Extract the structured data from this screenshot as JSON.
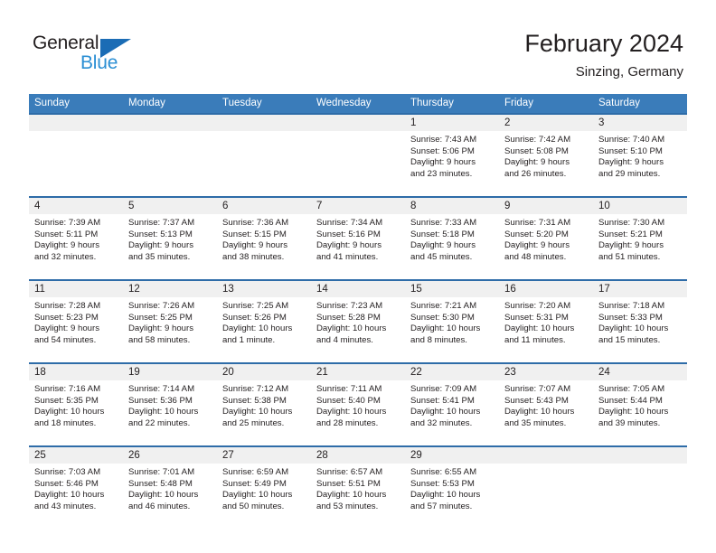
{
  "brand": {
    "name_top": "General",
    "name_bottom": "Blue",
    "color_dark": "#231f20",
    "color_blue": "#2b8fd4",
    "triangle_color": "#1b6cb5"
  },
  "header": {
    "title": "February 2024",
    "subtitle": "Sinzing, Germany"
  },
  "theme": {
    "header_bg": "#3a7cba",
    "row_divider": "#2e6ca8",
    "daynum_bg": "#f0f0f0",
    "body_bg": "#ffffff",
    "text": "#231f20"
  },
  "weekdays": [
    "Sunday",
    "Monday",
    "Tuesday",
    "Wednesday",
    "Thursday",
    "Friday",
    "Saturday"
  ],
  "weeks": [
    [
      {
        "day": "",
        "sunrise": "",
        "sunset": "",
        "daylight_line1": "",
        "daylight_line2": ""
      },
      {
        "day": "",
        "sunrise": "",
        "sunset": "",
        "daylight_line1": "",
        "daylight_line2": ""
      },
      {
        "day": "",
        "sunrise": "",
        "sunset": "",
        "daylight_line1": "",
        "daylight_line2": ""
      },
      {
        "day": "",
        "sunrise": "",
        "sunset": "",
        "daylight_line1": "",
        "daylight_line2": ""
      },
      {
        "day": "1",
        "sunrise": "Sunrise: 7:43 AM",
        "sunset": "Sunset: 5:06 PM",
        "daylight_line1": "Daylight: 9 hours",
        "daylight_line2": "and 23 minutes."
      },
      {
        "day": "2",
        "sunrise": "Sunrise: 7:42 AM",
        "sunset": "Sunset: 5:08 PM",
        "daylight_line1": "Daylight: 9 hours",
        "daylight_line2": "and 26 minutes."
      },
      {
        "day": "3",
        "sunrise": "Sunrise: 7:40 AM",
        "sunset": "Sunset: 5:10 PM",
        "daylight_line1": "Daylight: 9 hours",
        "daylight_line2": "and 29 minutes."
      }
    ],
    [
      {
        "day": "4",
        "sunrise": "Sunrise: 7:39 AM",
        "sunset": "Sunset: 5:11 PM",
        "daylight_line1": "Daylight: 9 hours",
        "daylight_line2": "and 32 minutes."
      },
      {
        "day": "5",
        "sunrise": "Sunrise: 7:37 AM",
        "sunset": "Sunset: 5:13 PM",
        "daylight_line1": "Daylight: 9 hours",
        "daylight_line2": "and 35 minutes."
      },
      {
        "day": "6",
        "sunrise": "Sunrise: 7:36 AM",
        "sunset": "Sunset: 5:15 PM",
        "daylight_line1": "Daylight: 9 hours",
        "daylight_line2": "and 38 minutes."
      },
      {
        "day": "7",
        "sunrise": "Sunrise: 7:34 AM",
        "sunset": "Sunset: 5:16 PM",
        "daylight_line1": "Daylight: 9 hours",
        "daylight_line2": "and 41 minutes."
      },
      {
        "day": "8",
        "sunrise": "Sunrise: 7:33 AM",
        "sunset": "Sunset: 5:18 PM",
        "daylight_line1": "Daylight: 9 hours",
        "daylight_line2": "and 45 minutes."
      },
      {
        "day": "9",
        "sunrise": "Sunrise: 7:31 AM",
        "sunset": "Sunset: 5:20 PM",
        "daylight_line1": "Daylight: 9 hours",
        "daylight_line2": "and 48 minutes."
      },
      {
        "day": "10",
        "sunrise": "Sunrise: 7:30 AM",
        "sunset": "Sunset: 5:21 PM",
        "daylight_line1": "Daylight: 9 hours",
        "daylight_line2": "and 51 minutes."
      }
    ],
    [
      {
        "day": "11",
        "sunrise": "Sunrise: 7:28 AM",
        "sunset": "Sunset: 5:23 PM",
        "daylight_line1": "Daylight: 9 hours",
        "daylight_line2": "and 54 minutes."
      },
      {
        "day": "12",
        "sunrise": "Sunrise: 7:26 AM",
        "sunset": "Sunset: 5:25 PM",
        "daylight_line1": "Daylight: 9 hours",
        "daylight_line2": "and 58 minutes."
      },
      {
        "day": "13",
        "sunrise": "Sunrise: 7:25 AM",
        "sunset": "Sunset: 5:26 PM",
        "daylight_line1": "Daylight: 10 hours",
        "daylight_line2": "and 1 minute."
      },
      {
        "day": "14",
        "sunrise": "Sunrise: 7:23 AM",
        "sunset": "Sunset: 5:28 PM",
        "daylight_line1": "Daylight: 10 hours",
        "daylight_line2": "and 4 minutes."
      },
      {
        "day": "15",
        "sunrise": "Sunrise: 7:21 AM",
        "sunset": "Sunset: 5:30 PM",
        "daylight_line1": "Daylight: 10 hours",
        "daylight_line2": "and 8 minutes."
      },
      {
        "day": "16",
        "sunrise": "Sunrise: 7:20 AM",
        "sunset": "Sunset: 5:31 PM",
        "daylight_line1": "Daylight: 10 hours",
        "daylight_line2": "and 11 minutes."
      },
      {
        "day": "17",
        "sunrise": "Sunrise: 7:18 AM",
        "sunset": "Sunset: 5:33 PM",
        "daylight_line1": "Daylight: 10 hours",
        "daylight_line2": "and 15 minutes."
      }
    ],
    [
      {
        "day": "18",
        "sunrise": "Sunrise: 7:16 AM",
        "sunset": "Sunset: 5:35 PM",
        "daylight_line1": "Daylight: 10 hours",
        "daylight_line2": "and 18 minutes."
      },
      {
        "day": "19",
        "sunrise": "Sunrise: 7:14 AM",
        "sunset": "Sunset: 5:36 PM",
        "daylight_line1": "Daylight: 10 hours",
        "daylight_line2": "and 22 minutes."
      },
      {
        "day": "20",
        "sunrise": "Sunrise: 7:12 AM",
        "sunset": "Sunset: 5:38 PM",
        "daylight_line1": "Daylight: 10 hours",
        "daylight_line2": "and 25 minutes."
      },
      {
        "day": "21",
        "sunrise": "Sunrise: 7:11 AM",
        "sunset": "Sunset: 5:40 PM",
        "daylight_line1": "Daylight: 10 hours",
        "daylight_line2": "and 28 minutes."
      },
      {
        "day": "22",
        "sunrise": "Sunrise: 7:09 AM",
        "sunset": "Sunset: 5:41 PM",
        "daylight_line1": "Daylight: 10 hours",
        "daylight_line2": "and 32 minutes."
      },
      {
        "day": "23",
        "sunrise": "Sunrise: 7:07 AM",
        "sunset": "Sunset: 5:43 PM",
        "daylight_line1": "Daylight: 10 hours",
        "daylight_line2": "and 35 minutes."
      },
      {
        "day": "24",
        "sunrise": "Sunrise: 7:05 AM",
        "sunset": "Sunset: 5:44 PM",
        "daylight_line1": "Daylight: 10 hours",
        "daylight_line2": "and 39 minutes."
      }
    ],
    [
      {
        "day": "25",
        "sunrise": "Sunrise: 7:03 AM",
        "sunset": "Sunset: 5:46 PM",
        "daylight_line1": "Daylight: 10 hours",
        "daylight_line2": "and 43 minutes."
      },
      {
        "day": "26",
        "sunrise": "Sunrise: 7:01 AM",
        "sunset": "Sunset: 5:48 PM",
        "daylight_line1": "Daylight: 10 hours",
        "daylight_line2": "and 46 minutes."
      },
      {
        "day": "27",
        "sunrise": "Sunrise: 6:59 AM",
        "sunset": "Sunset: 5:49 PM",
        "daylight_line1": "Daylight: 10 hours",
        "daylight_line2": "and 50 minutes."
      },
      {
        "day": "28",
        "sunrise": "Sunrise: 6:57 AM",
        "sunset": "Sunset: 5:51 PM",
        "daylight_line1": "Daylight: 10 hours",
        "daylight_line2": "and 53 minutes."
      },
      {
        "day": "29",
        "sunrise": "Sunrise: 6:55 AM",
        "sunset": "Sunset: 5:53 PM",
        "daylight_line1": "Daylight: 10 hours",
        "daylight_line2": "and 57 minutes."
      },
      {
        "day": "",
        "sunrise": "",
        "sunset": "",
        "daylight_line1": "",
        "daylight_line2": ""
      },
      {
        "day": "",
        "sunrise": "",
        "sunset": "",
        "daylight_line1": "",
        "daylight_line2": ""
      }
    ]
  ]
}
